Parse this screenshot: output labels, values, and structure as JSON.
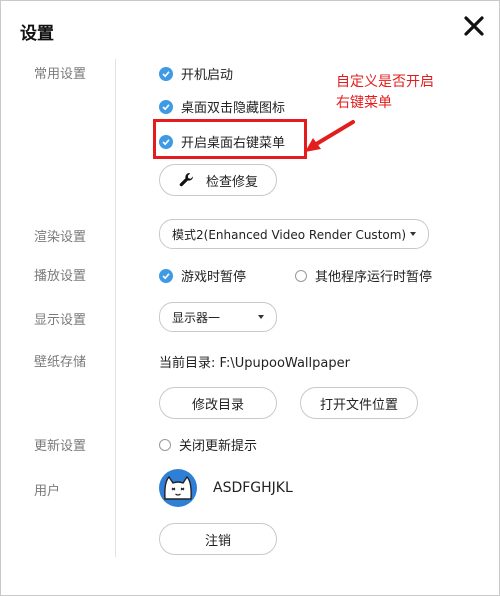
{
  "window": {
    "title": "设置"
  },
  "sections": {
    "general": "常用设置",
    "render": "渲染设置",
    "playback": "播放设置",
    "display": "显示设置",
    "storage": "壁纸存储",
    "update": "更新设置",
    "user": "用户"
  },
  "general": {
    "autostart": "开机启动",
    "double_click_hide_icons": "桌面双击隐藏图标",
    "desktop_context_menu": "开启桌面右键菜单",
    "repair_button": "检查修复"
  },
  "render": {
    "mode_selected": "模式2(Enhanced Video Render Custom)"
  },
  "playback": {
    "pause_on_game": "游戏时暂停",
    "pause_on_other_program": "其他程序运行时暂停"
  },
  "display": {
    "monitor_selected": "显示器一"
  },
  "storage": {
    "current_dir_label": "当前目录:",
    "current_dir_value": "F:\\UpupooWallpaper",
    "change_dir_button": "修改目录",
    "open_location_button": "打开文件位置"
  },
  "update": {
    "disable_update_prompt": "关闭更新提示"
  },
  "user": {
    "username": "ASDFGHJKL",
    "logout_button": "注销"
  },
  "annotation": {
    "line1": "自定义是否开启",
    "line2": "右键菜单"
  },
  "colors": {
    "accent": "#3f9ae6",
    "annotation": "#e31d1d",
    "avatar_blue": "#2f7fd6"
  }
}
